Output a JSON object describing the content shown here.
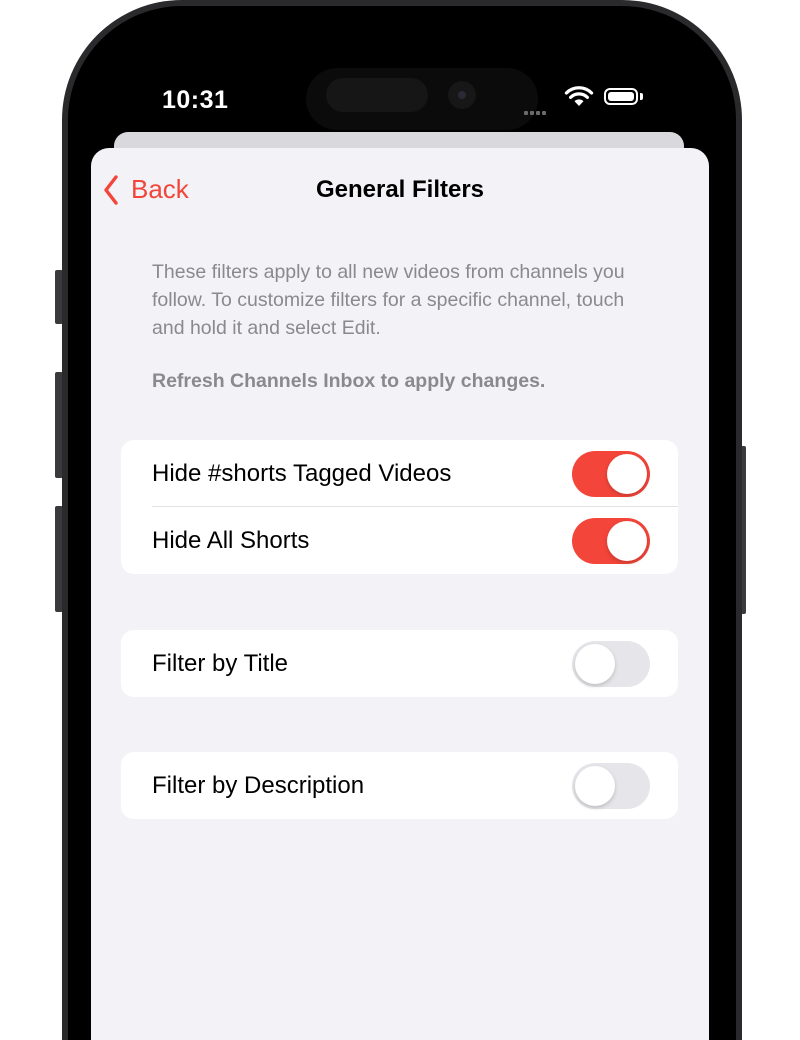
{
  "status_bar": {
    "time": "10:31"
  },
  "nav": {
    "back_label": "Back",
    "title": "General Filters"
  },
  "description": {
    "text": "These filters apply to all new videos from channels you follow. To customize filters for a specific channel, touch and hold it and select Edit.",
    "note": "Refresh Channels Inbox to apply changes."
  },
  "groups": [
    {
      "rows": [
        {
          "label": "Hide #shorts Tagged Videos",
          "enabled": true
        },
        {
          "label": "Hide All Shorts",
          "enabled": true
        }
      ]
    },
    {
      "rows": [
        {
          "label": "Filter by Title",
          "enabled": false
        }
      ]
    },
    {
      "rows": [
        {
          "label": "Filter by Description",
          "enabled": false
        }
      ]
    }
  ],
  "colors": {
    "accent": "#f3453a",
    "background": "#f2f2f7",
    "secondary_text": "#8a8a8e"
  },
  "icons": {
    "back": "chevron-left-icon",
    "wifi": "wifi-icon",
    "battery": "battery-icon"
  }
}
